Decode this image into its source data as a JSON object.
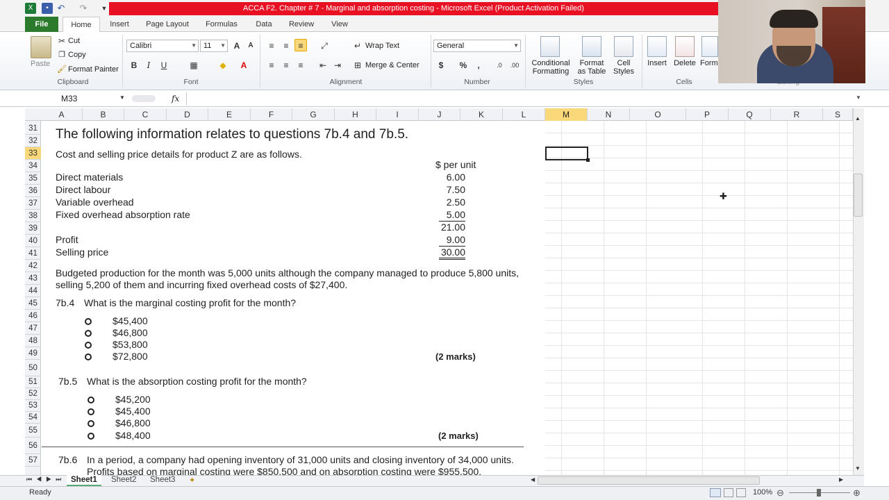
{
  "window": {
    "title": "ACCA F2. Chapter # 7 - Marginal and absorption costing  -  Microsoft Excel (Product Activation Failed)"
  },
  "tabs": [
    "File",
    "Home",
    "Insert",
    "Page Layout",
    "Formulas",
    "Data",
    "Review",
    "View"
  ],
  "ribbon": {
    "clipboard": {
      "paste": "Paste",
      "cut": "Cut",
      "copy": "Copy",
      "format_painter": "Format Painter",
      "label": "Clipboard"
    },
    "font": {
      "name": "Calibri",
      "size": "11",
      "label": "Font",
      "bold": "B",
      "italic": "I",
      "underline": "U"
    },
    "alignment": {
      "wrap_text": "Wrap Text",
      "merge_center": "Merge & Center",
      "label": "Alignment"
    },
    "number": {
      "format": "General",
      "currency": "$",
      "percent": "%",
      "comma": ",",
      "label": "Number"
    },
    "styles": {
      "conditional": "Conditional",
      "conditional2": "Formatting",
      "format_as": "Format",
      "format_as2": "as Table",
      "cell": "Cell",
      "cell2": "Styles",
      "label": "Styles"
    },
    "cells": {
      "insert": "Insert",
      "delete": "Delete",
      "format": "Form",
      "label": "Cells"
    },
    "editing": {
      "label": "Editing"
    }
  },
  "formula_bar": {
    "name_box": "M33",
    "fx": "fx",
    "value": ""
  },
  "columns": [
    "A",
    "B",
    "C",
    "D",
    "E",
    "F",
    "G",
    "H",
    "I",
    "J",
    "K",
    "L",
    "M",
    "N",
    "O",
    "P",
    "Q",
    "R",
    "S"
  ],
  "rows": [
    "31",
    "32",
    "33",
    "34",
    "35",
    "36",
    "37",
    "38",
    "39",
    "40",
    "41",
    "42",
    "43",
    "44",
    "45",
    "46",
    "47",
    "48",
    "49",
    "50",
    "51",
    "52",
    "53",
    "54",
    "55",
    "56",
    "57"
  ],
  "content": {
    "heading": "The following information relates to questions 7b.4 and 7b.5.",
    "intro": "Cost and selling price details for product Z are as follows.",
    "unit_header": "$ per unit",
    "cost_items": [
      {
        "label": "Direct materials",
        "value": "6.00"
      },
      {
        "label": "Direct labour",
        "value": "7.50"
      },
      {
        "label": "Variable overhead",
        "value": "2.50"
      },
      {
        "label": "Fixed overhead absorption rate",
        "value": "5.00"
      }
    ],
    "subtotal": "21.00",
    "profit_label": "Profit",
    "profit_value": "9.00",
    "selling_label": "Selling price",
    "selling_value": "30.00",
    "para1": "Budgeted production for the month was 5,000 units although the company managed to produce 5,800 units,",
    "para2": "selling 5,200 of them and incurring fixed overhead costs of $27,400.",
    "q4_no": "7b.4",
    "q4_text": "What is the marginal costing profit for the month?",
    "q4_options": [
      "$45,400",
      "$46,800",
      "$53,800",
      "$72,800"
    ],
    "q4_marks": "(2 marks)",
    "q5_no": "7b.5",
    "q5_text": "What is the absorption costing profit for the month?",
    "q5_options": [
      "$45,200",
      "$45,400",
      "$46,800",
      "$48,400"
    ],
    "q5_marks": "(2 marks)",
    "q6_no": "7b.6",
    "q6_line1": "In a period, a company had opening inventory of 31,000 units and closing inventory of 34,000 units.",
    "q6_line2": "Profits based on marginal costing were $850,500 and on absorption costing were $955,500."
  },
  "sheets": [
    "Sheet1",
    "Sheet2",
    "Sheet3"
  ],
  "status": {
    "ready": "Ready",
    "zoom": "100%"
  }
}
